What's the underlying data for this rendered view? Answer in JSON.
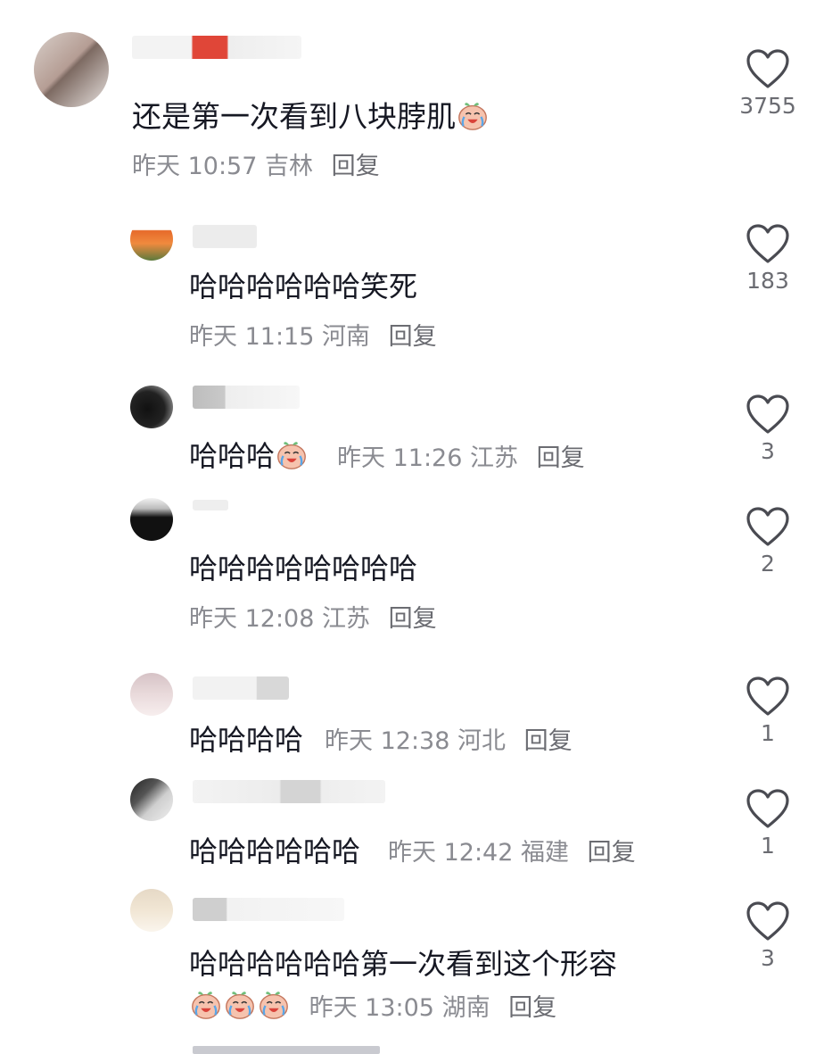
{
  "comments": [
    {
      "text": "还是第一次看到八块脖肌",
      "time": "昨天 10:57",
      "location": "吉林",
      "reply": "回复",
      "likes": "3755"
    },
    {
      "text": "哈哈哈哈哈哈笑死",
      "time": "昨天 11:15",
      "location": "河南",
      "reply": "回复",
      "likes": "183"
    },
    {
      "text": "哈哈哈",
      "time": "昨天 11:26",
      "location": "江苏",
      "reply": "回复",
      "likes": "3"
    },
    {
      "text": "哈哈哈哈哈哈哈哈",
      "time": "昨天 12:08",
      "location": "江苏",
      "reply": "回复",
      "likes": "2"
    },
    {
      "text": "哈哈哈哈",
      "time": "昨天 12:38",
      "location": "河北",
      "reply": "回复",
      "likes": "1"
    },
    {
      "text": "哈哈哈哈哈哈",
      "time": "昨天 12:42",
      "location": "福建",
      "reply": "回复",
      "likes": "1"
    },
    {
      "text": "哈哈哈哈哈哈第一次看到这个形容",
      "time": "昨天 13:05",
      "location": "湖南",
      "reply": "回复",
      "likes": "3"
    }
  ],
  "icons": {
    "like": "heart-outline-icon",
    "emoji": "crying-laughing-peach-emoji"
  },
  "colors": {
    "text": "#161823",
    "meta": "#8a8b91",
    "like_outline": "#4a4b52"
  }
}
